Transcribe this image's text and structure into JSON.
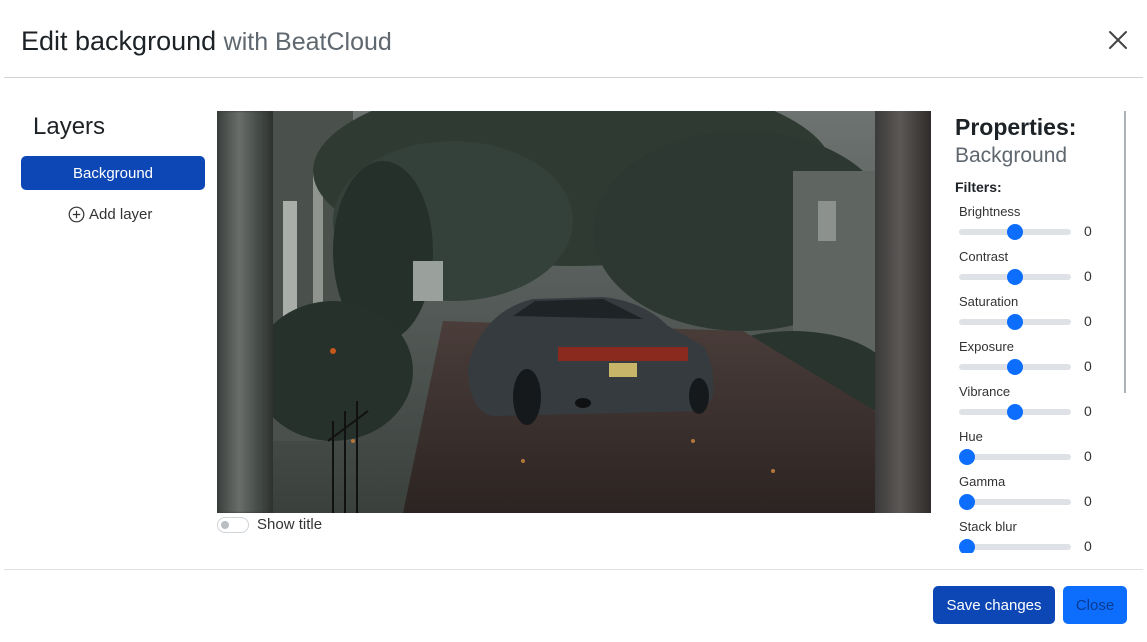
{
  "header": {
    "title": "Edit background",
    "subtitle": "with BeatCloud",
    "close_icon": "close-icon"
  },
  "layers": {
    "title": "Layers",
    "items": [
      {
        "label": "Background",
        "active": true
      }
    ],
    "add_label": "Add layer",
    "add_icon": "plus-circle-icon"
  },
  "canvas": {
    "show_title_label": "Show title",
    "show_title_enabled": false
  },
  "properties": {
    "title": "Properties:",
    "layer_name": "Background",
    "filters_label": "Filters:",
    "filters": [
      {
        "name": "Brightness",
        "value": "0",
        "level": 0.5
      },
      {
        "name": "Contrast",
        "value": "0",
        "level": 0.5
      },
      {
        "name": "Saturation",
        "value": "0",
        "level": 0.5
      },
      {
        "name": "Exposure",
        "value": "0",
        "level": 0.5
      },
      {
        "name": "Vibrance",
        "value": "0",
        "level": 0.5
      },
      {
        "name": "Hue",
        "value": "0",
        "level": 0.0
      },
      {
        "name": "Gamma",
        "value": "0",
        "level": 0.0
      },
      {
        "name": "Stack blur",
        "value": "0",
        "level": 0.0
      }
    ]
  },
  "footer": {
    "save_label": "Save changes",
    "close_label": "Close"
  },
  "colors": {
    "primary_dark": "#0d47b5",
    "primary": "#0d6efd",
    "slider_track": "#dee2e6"
  }
}
